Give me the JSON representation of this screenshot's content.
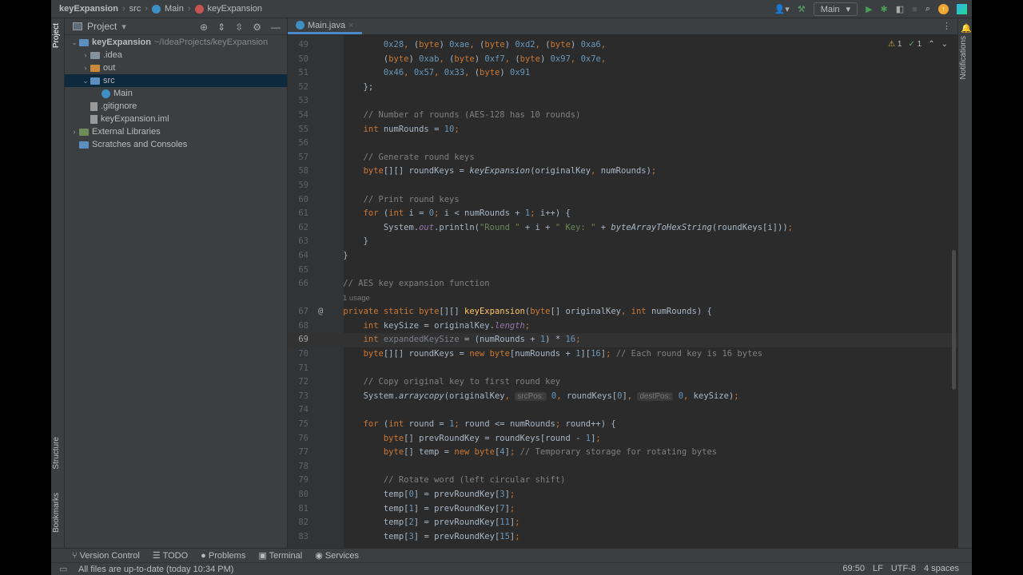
{
  "breadcrumb": [
    "keyExpansion",
    "src",
    "Main",
    "keyExpansion"
  ],
  "toolbar": {
    "run_config": "Main"
  },
  "left_strip": {
    "project": "Project",
    "structure": "Structure",
    "bookmarks": "Bookmarks"
  },
  "right_strip": {
    "notifications": "Notifications"
  },
  "project_panel": {
    "title": "Project",
    "tree": [
      {
        "label": "keyExpansion",
        "extra": "~/IdeaProjects/keyExpansion",
        "depth": 0,
        "arrow": "⌄",
        "icon": "folder blue",
        "bold": true
      },
      {
        "label": ".idea",
        "depth": 1,
        "arrow": "›",
        "icon": "folder"
      },
      {
        "label": "out",
        "depth": 1,
        "arrow": "›",
        "icon": "folder orange"
      },
      {
        "label": "src",
        "depth": 1,
        "arrow": "⌄",
        "icon": "folder blue",
        "selected": true
      },
      {
        "label": "Main",
        "depth": 2,
        "arrow": "",
        "icon": "class"
      },
      {
        "label": ".gitignore",
        "depth": 1,
        "arrow": "",
        "icon": "file"
      },
      {
        "label": "keyExpansion.iml",
        "depth": 1,
        "arrow": "",
        "icon": "file"
      },
      {
        "label": "External Libraries",
        "depth": 0,
        "arrow": "›",
        "icon": "lib"
      },
      {
        "label": "Scratches and Consoles",
        "depth": 0,
        "arrow": "",
        "icon": "scratch"
      }
    ]
  },
  "editor": {
    "tab": "Main.java",
    "warnings": "1",
    "ok": "1",
    "lines": [
      {
        "n": "49",
        "t": [
          [
            "p",
            "            "
          ],
          [
            "n",
            "0x28"
          ],
          [
            "k",
            ", "
          ],
          [
            "p",
            "("
          ],
          [
            "k",
            "byte"
          ],
          [
            "p",
            ") "
          ],
          [
            "n",
            "0xae"
          ],
          [
            "k",
            ", "
          ],
          [
            "p",
            "("
          ],
          [
            "k",
            "byte"
          ],
          [
            "p",
            ") "
          ],
          [
            "n",
            "0xd2"
          ],
          [
            "k",
            ", "
          ],
          [
            "p",
            "("
          ],
          [
            "k",
            "byte"
          ],
          [
            "p",
            ") "
          ],
          [
            "n",
            "0xa6"
          ],
          [
            "k",
            ","
          ]
        ]
      },
      {
        "n": "50",
        "t": [
          [
            "p",
            "            ("
          ],
          [
            "k",
            "byte"
          ],
          [
            "p",
            ") "
          ],
          [
            "n",
            "0xab"
          ],
          [
            "k",
            ", "
          ],
          [
            "p",
            "("
          ],
          [
            "k",
            "byte"
          ],
          [
            "p",
            ") "
          ],
          [
            "n",
            "0xf7"
          ],
          [
            "k",
            ", "
          ],
          [
            "p",
            "("
          ],
          [
            "k",
            "byte"
          ],
          [
            "p",
            ") "
          ],
          [
            "n",
            "0x97"
          ],
          [
            "k",
            ", "
          ],
          [
            "n",
            "0x7e"
          ],
          [
            "k",
            ","
          ]
        ]
      },
      {
        "n": "51",
        "t": [
          [
            "p",
            "            "
          ],
          [
            "n",
            "0x46"
          ],
          [
            "k",
            ", "
          ],
          [
            "n",
            "0x57"
          ],
          [
            "k",
            ", "
          ],
          [
            "n",
            "0x33"
          ],
          [
            "k",
            ", "
          ],
          [
            "p",
            "("
          ],
          [
            "k",
            "byte"
          ],
          [
            "p",
            ") "
          ],
          [
            "n",
            "0x91"
          ]
        ]
      },
      {
        "n": "52",
        "t": [
          [
            "p",
            "        };"
          ]
        ]
      },
      {
        "n": "53",
        "t": []
      },
      {
        "n": "54",
        "t": [
          [
            "c",
            "        // Number of rounds (AES-128 has 10 rounds)"
          ]
        ]
      },
      {
        "n": "55",
        "t": [
          [
            "k",
            "        int "
          ],
          [
            "p",
            "numRounds = "
          ],
          [
            "n",
            "10"
          ],
          [
            "k",
            ";"
          ]
        ]
      },
      {
        "n": "56",
        "t": []
      },
      {
        "n": "57",
        "t": [
          [
            "c",
            "        // Generate round keys"
          ]
        ]
      },
      {
        "n": "58",
        "t": [
          [
            "k",
            "        byte"
          ],
          [
            "p",
            "[][] roundKeys = "
          ],
          [
            "mi",
            "keyExpansion"
          ],
          [
            "p",
            "(originalKey"
          ],
          [
            "k",
            ", "
          ],
          [
            "p",
            "numRounds)"
          ],
          [
            "k",
            ";"
          ]
        ]
      },
      {
        "n": "59",
        "t": []
      },
      {
        "n": "60",
        "t": [
          [
            "c",
            "        // Print round keys"
          ]
        ]
      },
      {
        "n": "61",
        "t": [
          [
            "k",
            "        for "
          ],
          [
            "p",
            "("
          ],
          [
            "k",
            "int "
          ],
          [
            "p",
            "i = "
          ],
          [
            "n",
            "0"
          ],
          [
            "k",
            "; "
          ],
          [
            "p",
            "i < numRounds + "
          ],
          [
            "n",
            "1"
          ],
          [
            "k",
            "; "
          ],
          [
            "p",
            "i++) {"
          ]
        ]
      },
      {
        "n": "62",
        "t": [
          [
            "p",
            "            System."
          ],
          [
            "f",
            "out"
          ],
          [
            "p",
            ".println("
          ],
          [
            "s",
            "\"Round \""
          ],
          [
            "p",
            " + i + "
          ],
          [
            "s",
            "\" Key: \""
          ],
          [
            "p",
            " + "
          ],
          [
            "mi",
            "byteArrayToHexString"
          ],
          [
            "p",
            "(roundKeys[i]))"
          ],
          [
            "k",
            ";"
          ]
        ]
      },
      {
        "n": "63",
        "t": [
          [
            "p",
            "        }"
          ]
        ]
      },
      {
        "n": "64",
        "t": [
          [
            "p",
            "    }"
          ]
        ]
      },
      {
        "n": "65",
        "t": []
      },
      {
        "n": "66",
        "t": [
          [
            "c",
            "    // AES key expansion function"
          ]
        ]
      },
      {
        "n": "",
        "usage": "1 usage",
        "t": []
      },
      {
        "n": "67",
        "t": [
          [
            "k",
            "    private static byte"
          ],
          [
            "p",
            "[][] "
          ],
          [
            "m",
            "keyExpansion"
          ],
          [
            "p",
            "("
          ],
          [
            "k",
            "byte"
          ],
          [
            "p",
            "[] originalKey"
          ],
          [
            "k",
            ", int "
          ],
          [
            "p",
            "numRounds) {"
          ]
        ]
      },
      {
        "n": "68",
        "t": [
          [
            "k",
            "        int "
          ],
          [
            "p",
            "keySize = originalKey."
          ],
          [
            "f",
            "length"
          ],
          [
            "k",
            ";"
          ]
        ]
      },
      {
        "n": "69",
        "cur": true,
        "t": [
          [
            "k",
            "        int "
          ],
          [
            "u",
            "expandedKeySize"
          ],
          [
            "p",
            " = (numRounds + "
          ],
          [
            "n",
            "1"
          ],
          [
            "p",
            ") * "
          ],
          [
            "n",
            "16"
          ],
          [
            "k",
            ";"
          ]
        ]
      },
      {
        "n": "70",
        "t": [
          [
            "k",
            "        byte"
          ],
          [
            "p",
            "[][] roundKeys = "
          ],
          [
            "k",
            "new byte"
          ],
          [
            "p",
            "[numRounds + "
          ],
          [
            "n",
            "1"
          ],
          [
            "p",
            "]["
          ],
          [
            "n",
            "16"
          ],
          [
            "p",
            "]"
          ],
          [
            "k",
            "; "
          ],
          [
            "c",
            "// Each round key is 16 bytes"
          ]
        ]
      },
      {
        "n": "71",
        "t": []
      },
      {
        "n": "72",
        "t": [
          [
            "c",
            "        // Copy original key to first round key"
          ]
        ]
      },
      {
        "n": "73",
        "t": [
          [
            "p",
            "        System."
          ],
          [
            "mi",
            "arraycopy"
          ],
          [
            "p",
            "(originalKey"
          ],
          [
            "k",
            ", "
          ],
          [
            "h",
            "srcPos:"
          ],
          [
            "p",
            " "
          ],
          [
            "n",
            "0"
          ],
          [
            "k",
            ", "
          ],
          [
            "p",
            "roundKeys["
          ],
          [
            "n",
            "0"
          ],
          [
            "p",
            "]"
          ],
          [
            "k",
            ", "
          ],
          [
            "h",
            "destPos:"
          ],
          [
            "p",
            " "
          ],
          [
            "n",
            "0"
          ],
          [
            "k",
            ", "
          ],
          [
            "p",
            "keySize)"
          ],
          [
            "k",
            ";"
          ]
        ]
      },
      {
        "n": "74",
        "t": []
      },
      {
        "n": "75",
        "t": [
          [
            "k",
            "        for "
          ],
          [
            "p",
            "("
          ],
          [
            "k",
            "int "
          ],
          [
            "p",
            "round = "
          ],
          [
            "n",
            "1"
          ],
          [
            "k",
            "; "
          ],
          [
            "p",
            "round <= numRounds"
          ],
          [
            "k",
            "; "
          ],
          [
            "p",
            "round++) {"
          ]
        ]
      },
      {
        "n": "76",
        "t": [
          [
            "k",
            "            byte"
          ],
          [
            "p",
            "[] prevRoundKey = roundKeys[round - "
          ],
          [
            "n",
            "1"
          ],
          [
            "p",
            "]"
          ],
          [
            "k",
            ";"
          ]
        ]
      },
      {
        "n": "77",
        "t": [
          [
            "k",
            "            byte"
          ],
          [
            "p",
            "[] temp = "
          ],
          [
            "k",
            "new byte"
          ],
          [
            "p",
            "["
          ],
          [
            "n",
            "4"
          ],
          [
            "p",
            "]"
          ],
          [
            "k",
            "; "
          ],
          [
            "c",
            "// Temporary storage for rotating bytes"
          ]
        ]
      },
      {
        "n": "78",
        "t": []
      },
      {
        "n": "79",
        "t": [
          [
            "c",
            "            // Rotate word (left circular shift)"
          ]
        ]
      },
      {
        "n": "80",
        "t": [
          [
            "p",
            "            temp["
          ],
          [
            "n",
            "0"
          ],
          [
            "p",
            "] = prevRoundKey["
          ],
          [
            "n",
            "3"
          ],
          [
            "p",
            "]"
          ],
          [
            "k",
            ";"
          ]
        ]
      },
      {
        "n": "81",
        "t": [
          [
            "p",
            "            temp["
          ],
          [
            "n",
            "1"
          ],
          [
            "p",
            "] = prevRoundKey["
          ],
          [
            "n",
            "7"
          ],
          [
            "p",
            "]"
          ],
          [
            "k",
            ";"
          ]
        ]
      },
      {
        "n": "82",
        "t": [
          [
            "p",
            "            temp["
          ],
          [
            "n",
            "2"
          ],
          [
            "p",
            "] = prevRoundKey["
          ],
          [
            "n",
            "11"
          ],
          [
            "p",
            "]"
          ],
          [
            "k",
            ";"
          ]
        ]
      },
      {
        "n": "83",
        "t": [
          [
            "p",
            "            temp["
          ],
          [
            "n",
            "3"
          ],
          [
            "p",
            "] = prevRoundKey["
          ],
          [
            "n",
            "15"
          ],
          [
            "p",
            "]"
          ],
          [
            "k",
            ";"
          ]
        ]
      }
    ]
  },
  "bottom_tools": [
    "Version Control",
    "TODO",
    "Problems",
    "Terminal",
    "Services"
  ],
  "status": {
    "message": "All files are up-to-date (today 10:34 PM)",
    "position": "69:50",
    "line_sep": "LF",
    "encoding": "UTF-8",
    "indent": "4 spaces"
  }
}
